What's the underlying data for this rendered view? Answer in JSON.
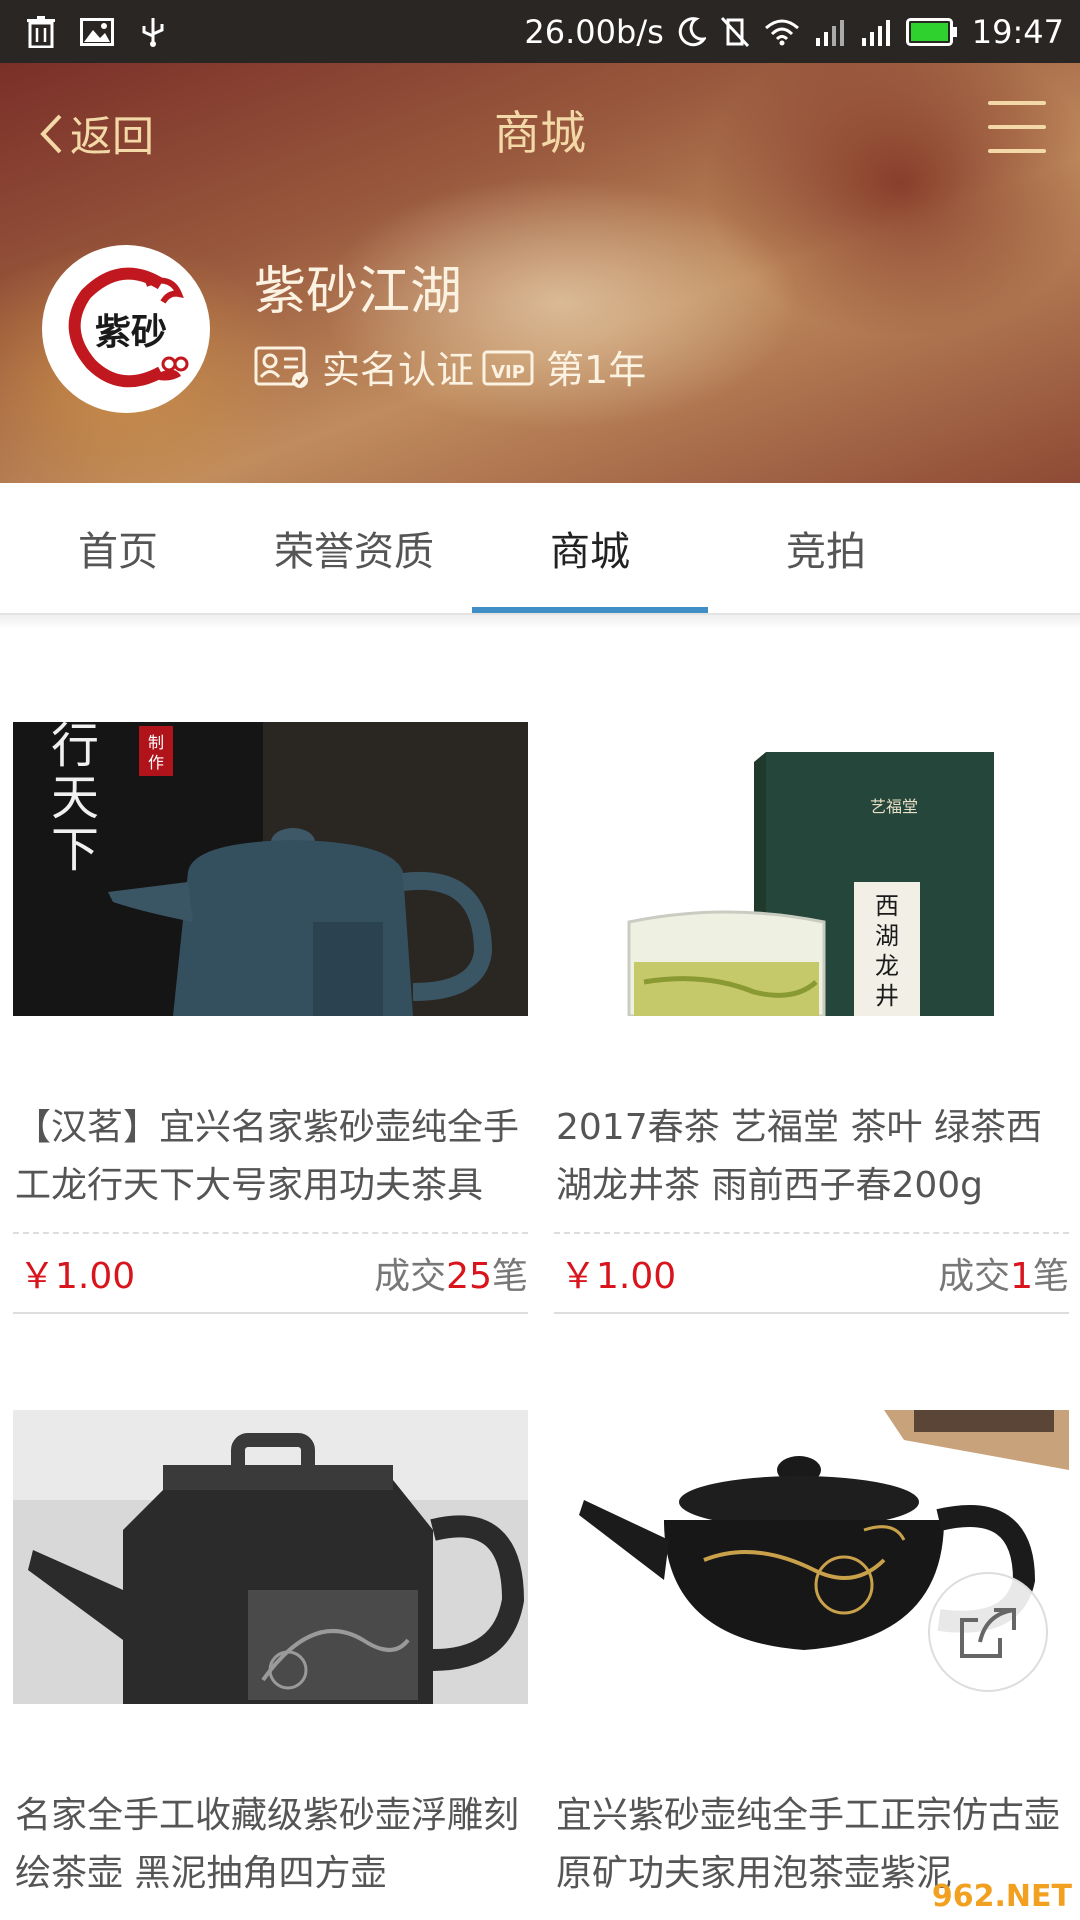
{
  "status_bar": {
    "speed": "26.00b/s",
    "time": "19:47"
  },
  "nav": {
    "back_label": "返回",
    "title": "商城"
  },
  "shop": {
    "name": "紫砂江湖",
    "logo_text": "紫砂",
    "verified_label": "实名认证",
    "vip_label": "VIP",
    "vip_years": "第1年"
  },
  "tabs": [
    {
      "label": "首页"
    },
    {
      "label": "荣誉资质"
    },
    {
      "label": "商城"
    },
    {
      "label": "竞拍"
    }
  ],
  "active_tab": "商城",
  "products": [
    {
      "title": "【汉茗】宜兴名家紫砂壶纯全手工龙行天下大号家用功夫茶具",
      "price": "￥1.00",
      "deals_prefix": "成交",
      "deals_count": "25",
      "deals_suffix": "笔",
      "image_text": "行天下",
      "image_seal": "制作"
    },
    {
      "title": "2017春茶 艺福堂 茶叶 绿茶西湖龙井茶 雨前西子春200g",
      "price": "￥1.00",
      "deals_prefix": "成交",
      "deals_count": "1",
      "deals_suffix": "笔",
      "image_text": "西湖龙井",
      "image_brand": "艺福堂"
    },
    {
      "title": "名家全手工收藏级紫砂壶浮雕刻绘茶壶 黑泥抽角四方壶",
      "price": "",
      "deals_prefix": "",
      "deals_count": "",
      "deals_suffix": ""
    },
    {
      "title": "宜兴紫砂壶纯全手工正宗仿古壶原矿功夫家用泡茶壶紫泥",
      "price": "",
      "deals_prefix": "",
      "deals_count": "",
      "deals_suffix": ""
    }
  ],
  "watermark": "962.NET",
  "colors": {
    "accent": "#3f8fc6",
    "price": "#d8141c",
    "header_text": "#f3d9a8"
  }
}
